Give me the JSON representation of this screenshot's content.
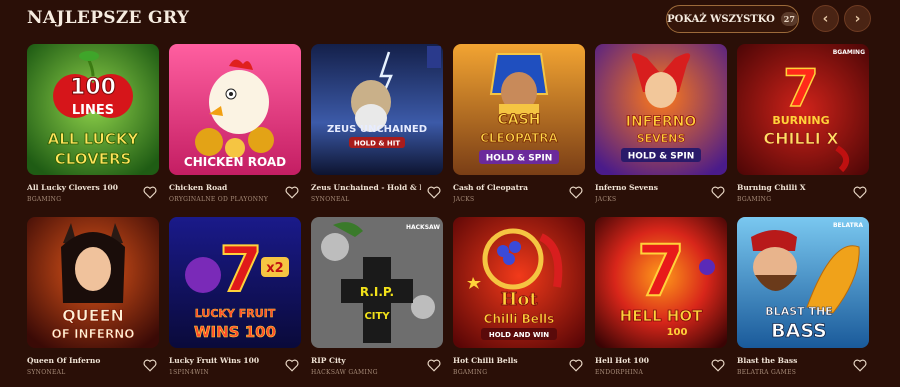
{
  "header": {
    "title": "Najlepsze gry",
    "show_all_label": "Pokaż wszystko",
    "count": "27"
  },
  "icons": {
    "prev": "chevron-left-icon",
    "next": "chevron-right-icon",
    "favorite": "heart-icon"
  },
  "colors": {
    "background": "#2a0f07",
    "accent_border": "#9c6a3a"
  },
  "games": [
    {
      "name": "All Lucky Clovers 100",
      "provider": "BGaming",
      "art_text": [
        "100",
        "LINES",
        "ALL LUCKY",
        "CLOVERS"
      ]
    },
    {
      "name": "Chicken Road",
      "provider": "Oryginalne od Playonny",
      "art_text": [
        "CHICKEN ROAD"
      ]
    },
    {
      "name": "Zeus Unchained - Hold & Hit",
      "provider": "Synoneal",
      "art_text": [
        "ZEUS UNCHAINED",
        "HOLD & HIT"
      ]
    },
    {
      "name": "Cash of Cleopatra",
      "provider": "Jacks",
      "art_text": [
        "CASH",
        "CLEOPATRA",
        "HOLD & SPIN"
      ]
    },
    {
      "name": "Inferno Sevens",
      "provider": "Jacks",
      "art_text": [
        "INFERNO",
        "SEVENS",
        "HOLD & SPIN"
      ]
    },
    {
      "name": "Burning Chilli X",
      "provider": "BGaming",
      "art_text": [
        "BURNING",
        "CHILLI X",
        "BGAMING"
      ]
    },
    {
      "name": "Queen Of Inferno",
      "provider": "Synoneal",
      "art_text": [
        "QUEEN",
        "OF INFERNO"
      ]
    },
    {
      "name": "Lucky Fruit Wins 100",
      "provider": "1Spin4Win",
      "art_text": [
        "LUCKY FRUIT",
        "WINS 100",
        "x2"
      ]
    },
    {
      "name": "RIP City",
      "provider": "Hacksaw Gaming",
      "art_text": [
        "R.I.P.",
        "CITY",
        "HACKSAW"
      ]
    },
    {
      "name": "Hot Chilli Bells",
      "provider": "BGaming",
      "art_text": [
        "Hot",
        "Chilli Bells",
        "HOLD AND WIN"
      ]
    },
    {
      "name": "Hell Hot 100",
      "provider": "Endorphina",
      "art_text": [
        "HELL HOT",
        "100"
      ]
    },
    {
      "name": "Blast the Bass",
      "provider": "Belatra Games",
      "art_text": [
        "BLAST THE",
        "BASS",
        "BELATRA"
      ]
    }
  ]
}
